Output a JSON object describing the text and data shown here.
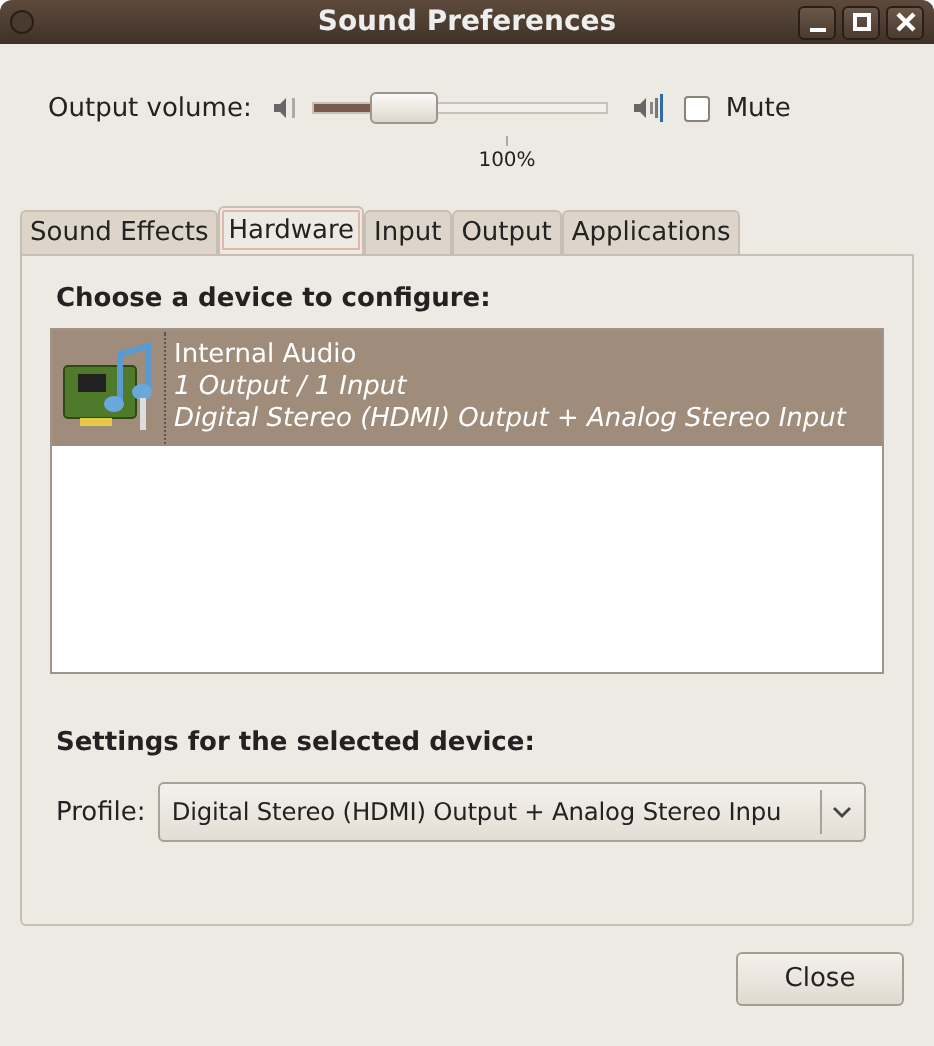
{
  "window": {
    "title": "Sound Preferences"
  },
  "volume": {
    "label": "Output volume:",
    "level": 0.23,
    "reading": "100%",
    "mute": {
      "label": "Mute",
      "checked": false
    }
  },
  "tabs": [
    {
      "label": "Sound Effects",
      "selected": false
    },
    {
      "label": "Hardware",
      "selected": true
    },
    {
      "label": "Input",
      "selected": false
    },
    {
      "label": "Output",
      "selected": false
    },
    {
      "label": "Applications",
      "selected": false
    }
  ],
  "devices": {
    "heading": "Choose a device to configure:",
    "items": [
      {
        "name": "Internal Audio",
        "ports": "1 Output / 1 Input",
        "profile": "Digital Stereo (HDMI) Output + Analog Stereo Input",
        "selected": true
      }
    ]
  },
  "settings": {
    "heading": "Settings for the selected device:",
    "profile_label": "Profile:",
    "profile_value": "Digital Stereo (HDMI) Output + Analog Stereo Inpu"
  },
  "buttons": [
    "Close"
  ]
}
